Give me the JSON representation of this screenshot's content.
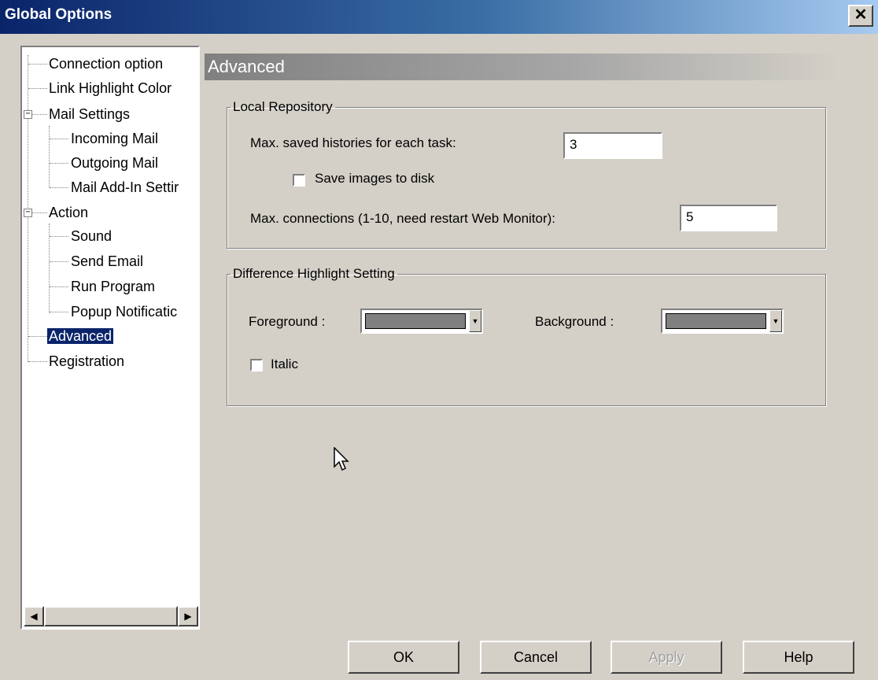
{
  "window": {
    "title": "Global Options",
    "close_glyph": "✕"
  },
  "tree": {
    "items": [
      {
        "label": "Connection option"
      },
      {
        "label": "Link Highlight Color"
      },
      {
        "label": "Mail Settings",
        "expander": "−"
      },
      {
        "label": "Incoming Mail"
      },
      {
        "label": "Outgoing Mail"
      },
      {
        "label": "Mail Add-In Settir"
      },
      {
        "label": "Action",
        "expander": "−"
      },
      {
        "label": "Sound"
      },
      {
        "label": "Send Email"
      },
      {
        "label": "Run Program"
      },
      {
        "label": "Popup Notificatic"
      },
      {
        "label": "Advanced",
        "selected": true
      },
      {
        "label": "Registration"
      }
    ],
    "scroll_left_glyph": "◀",
    "scroll_right_glyph": "▶"
  },
  "section": {
    "title": "Advanced"
  },
  "local_repository": {
    "legend": "Local Repository",
    "max_histories_label": "Max. saved histories for each task:",
    "max_histories_value": "3",
    "save_images_label": "Save images to disk",
    "save_images_checked": false,
    "max_connections_label": "Max. connections (1-10, need restart Web Monitor):",
    "max_connections_value": "5"
  },
  "difference_highlight": {
    "legend": "Difference Highlight Setting",
    "foreground_label": "Foreground :",
    "background_label": "Background :",
    "foreground_color": "#808080",
    "background_color": "#808080",
    "dropdown_glyph": "▼",
    "italic_label": "Italic",
    "italic_checked": false
  },
  "buttons": {
    "ok": "OK",
    "cancel": "Cancel",
    "apply": "Apply",
    "help": "Help"
  },
  "colors": {
    "titlebar_start": "#0a246a",
    "titlebar_end": "#a6caf0",
    "face": "#d4d0c8",
    "selection": "#0a246a"
  }
}
